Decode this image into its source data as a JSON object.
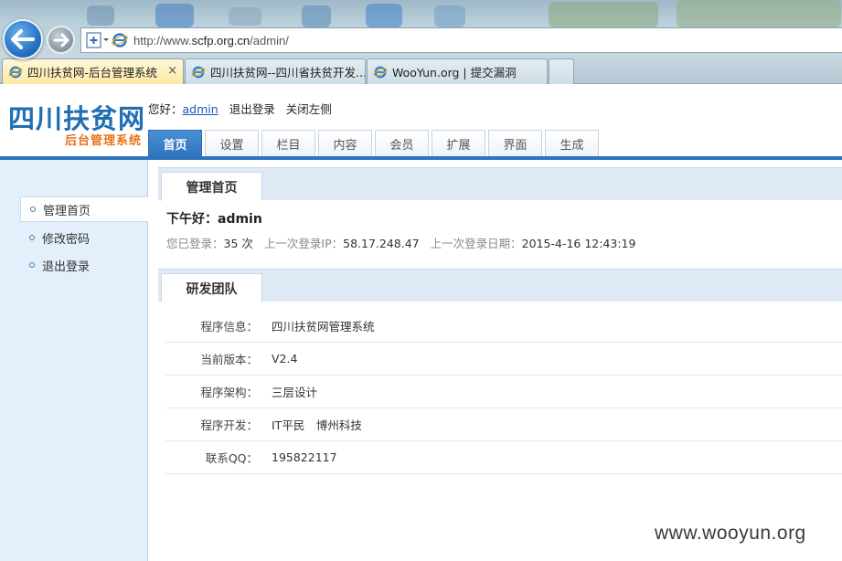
{
  "browser": {
    "address": {
      "prefix": "http://www.",
      "host": "scfp.org.cn",
      "path": "/admin/"
    },
    "tabs": [
      {
        "label": "四川扶贫网-后台管理系统",
        "active": true
      },
      {
        "label": "四川扶贫网--四川省扶贫开发...",
        "active": false
      },
      {
        "label": "WooYun.org | 提交漏洞",
        "active": false
      }
    ],
    "close_glyph": "×"
  },
  "header": {
    "logo_title": "四川扶贫网",
    "logo_subtitle": "后台管理系统",
    "greeting_label": "您好：",
    "username": "admin",
    "logout": "退出登录",
    "close_left": "关闭左侧"
  },
  "main_tabs": [
    "首页",
    "设置",
    "栏目",
    "内容",
    "会员",
    "扩展",
    "界面",
    "生成"
  ],
  "sidebar": {
    "items": [
      "管理首页",
      "修改密码",
      "退出登录"
    ]
  },
  "home": {
    "section_title": "管理首页",
    "greeting": "下午好：admin",
    "login_count_label": "您已登录：",
    "login_count": "35 次",
    "last_ip_label": "上一次登录IP：",
    "last_ip": "58.17.248.47",
    "last_date_label": "上一次登录日期：",
    "last_date": "2015-4-16 12:43:19"
  },
  "team": {
    "section_title": "研发团队",
    "rows": [
      {
        "key": "程序信息：",
        "value": "四川扶贫网管理系统"
      },
      {
        "key": "当前版本：",
        "value": "V2.4"
      },
      {
        "key": "程序架构：",
        "value": "三层设计"
      },
      {
        "key": "程序开发：",
        "value": "IT平民　博州科技"
      },
      {
        "key": "联系QQ：",
        "value": "195822117"
      }
    ]
  },
  "watermark": "www.wooyun.org",
  "colors": {
    "accent": "#2f74bf",
    "logo": "#1f6fb5",
    "subtitle": "#e8731a",
    "sidebar_bg": "#e3effa"
  }
}
